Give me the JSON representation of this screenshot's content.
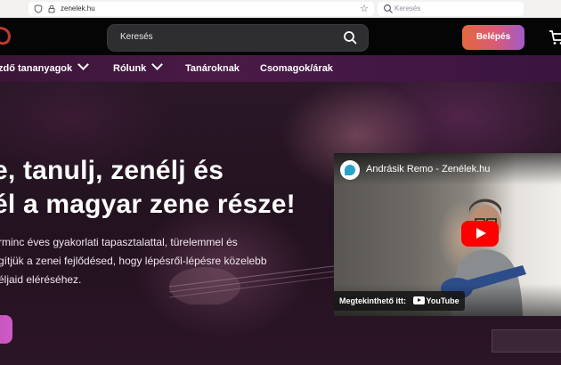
{
  "browser": {
    "url": "zenelek.hu",
    "search_placeholder": "Keresés"
  },
  "header": {
    "search_label": "Keresés",
    "login_label": "Belépés",
    "brand_color": "#c0392b",
    "login_gradient": [
      "#e3683f",
      "#d95a78",
      "#a05bc9"
    ]
  },
  "nav": {
    "items": [
      {
        "label": "zdő tananyagok",
        "has_dropdown": true
      },
      {
        "label": "Rólunk",
        "has_dropdown": true
      },
      {
        "label": "Tanároknak",
        "has_dropdown": false
      },
      {
        "label": "Csomagok/árak",
        "has_dropdown": false
      }
    ]
  },
  "hero": {
    "title_line1": "e, tanulj, zenélj és",
    "title_line2": "él a magyar zene része!",
    "text_line1": "rminc éves gyakorlati tapasztalattal, türelemmel és",
    "text_line2": "gítjük a zenei fejlődésed, hogy lépésről-lépésre közelebb",
    "text_line3": "éljaid eléréséhez."
  },
  "video": {
    "title": "Andrásik Remo - Zenélek.hu",
    "watch_on_label": "Megtekinthető itt:",
    "platform_label": "YouTube"
  }
}
